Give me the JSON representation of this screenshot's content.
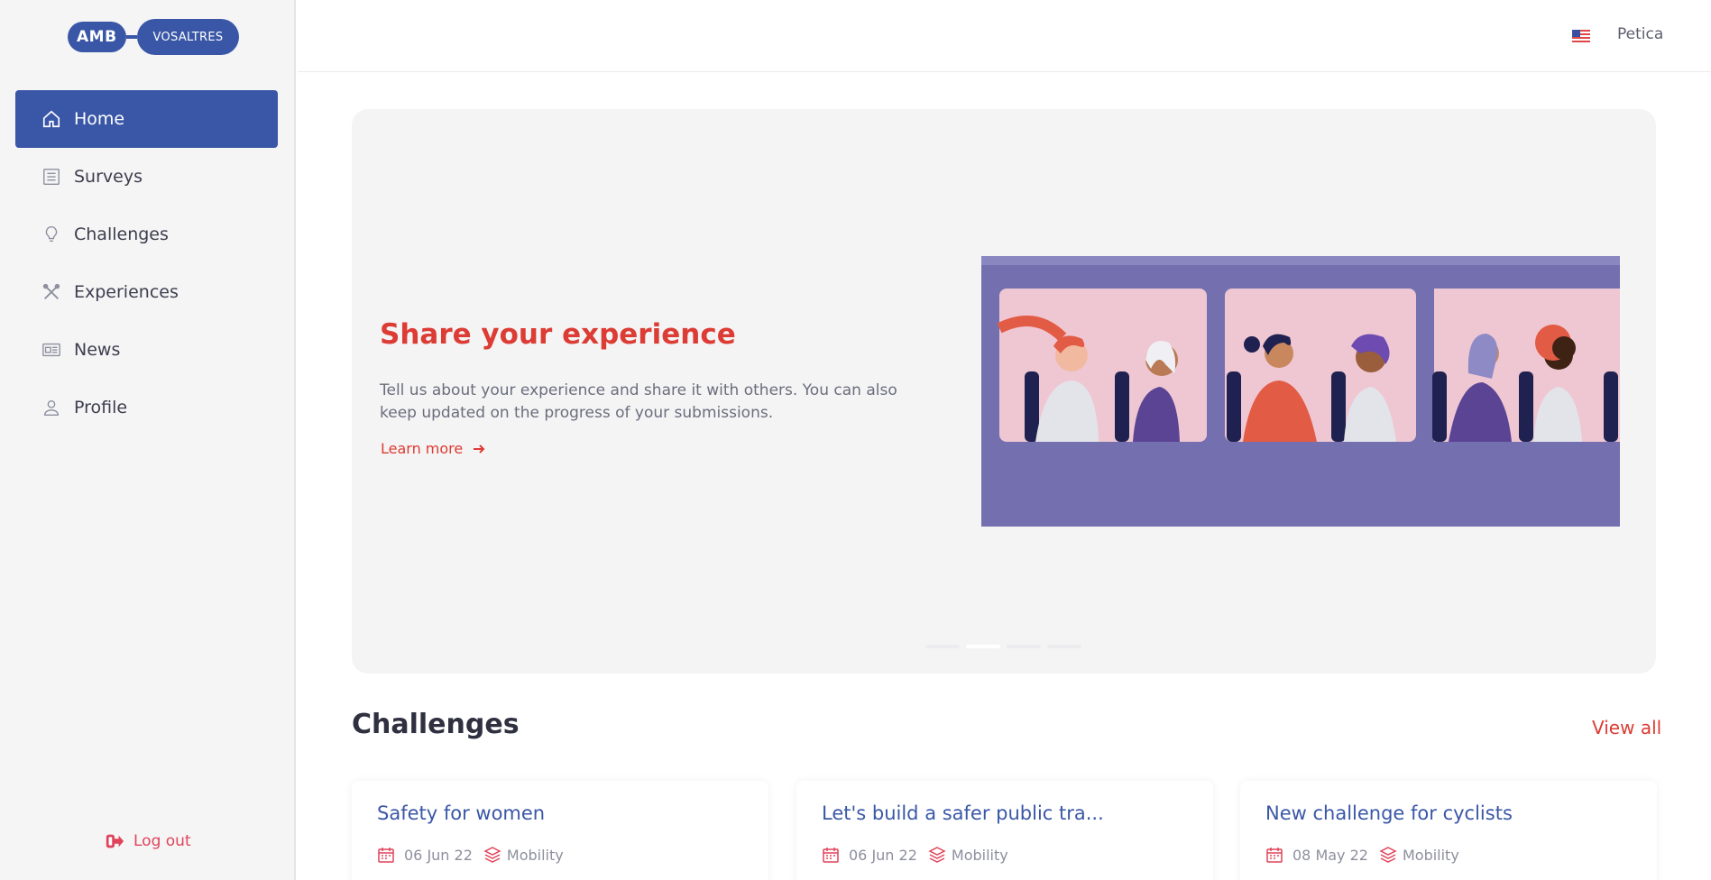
{
  "logo": {
    "part1": "AMB",
    "part2": "VOSALTRES"
  },
  "sidebar": {
    "items": [
      {
        "label": "Home",
        "icon": "home-icon",
        "active": true
      },
      {
        "label": "Surveys",
        "icon": "list-icon",
        "active": false
      },
      {
        "label": "Challenges",
        "icon": "lightbulb-icon",
        "active": false
      },
      {
        "label": "Experiences",
        "icon": "tools-icon",
        "active": false
      },
      {
        "label": "News",
        "icon": "newspaper-icon",
        "active": false
      },
      {
        "label": "Profile",
        "icon": "user-icon",
        "active": false
      }
    ],
    "logout_label": "Log out"
  },
  "header": {
    "username": "Petica",
    "language_flag": "us-flag-icon"
  },
  "hero": {
    "title": "Share your experience",
    "description": "Tell us about your experience and share it with others. You can also keep updated on the progress of your submissions.",
    "link_label": "Learn more",
    "active_slide": 2,
    "slide_count": 4
  },
  "challenges": {
    "title": "Challenges",
    "view_all": "View all",
    "cards": [
      {
        "title": "Safety for women",
        "date": "06 Jun 22",
        "category": "Mobility"
      },
      {
        "title": "Let's build a safer public tra...",
        "date": "06 Jun 22",
        "category": "Mobility"
      },
      {
        "title": "New challenge for cyclists",
        "date": "08 May 22",
        "category": "Mobility"
      }
    ]
  },
  "colors": {
    "primary": "#3a57a7",
    "accent": "#dc3c34",
    "sidebar_bg": "#f5f5f6",
    "hero_bg": "#f4f4f5"
  }
}
